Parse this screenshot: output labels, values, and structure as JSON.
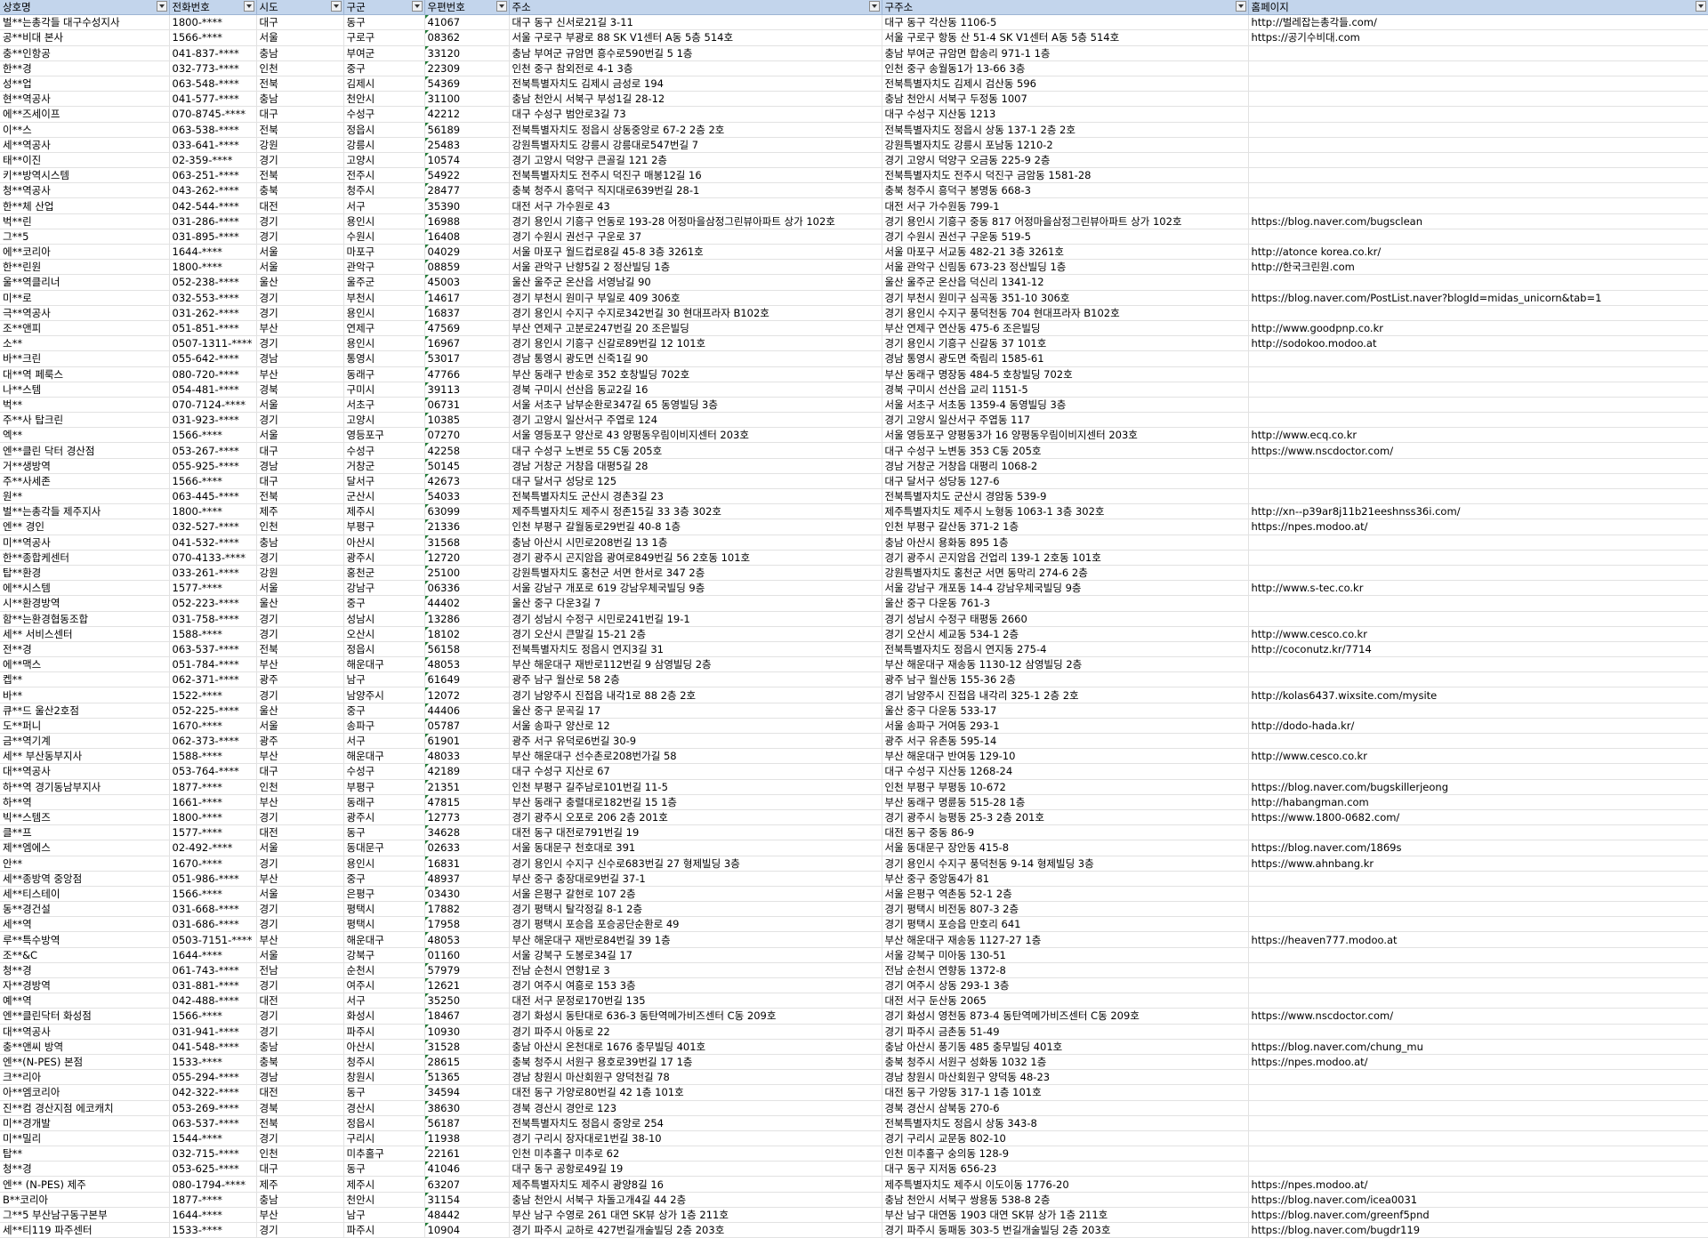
{
  "headers": [
    "상호명",
    "전화번호",
    "시도",
    "구군",
    "우편번호",
    "주소",
    "구주소",
    "홈페이지"
  ],
  "rows": [
    [
      "벌**는총각들 대구수성지사",
      "1800-****",
      "대구",
      "동구",
      "41067",
      "대구 동구 신서로21길 3-11",
      "대구 동구 각산동 1106-5",
      "http://벌레잡는총각들.com/"
    ],
    [
      "공**비대 본사",
      "1566-****",
      "서울",
      "구로구",
      "08362",
      "서울 구로구 부광로 88 SK V1센터 A동 5층 514호",
      "서울 구로구 항동 산 51-4 SK V1센터 A동 5층 514호",
      "https://공기수비대.com"
    ],
    [
      "충**인항공",
      "041-837-****",
      "충남",
      "부여군",
      "33120",
      "충남 부여군 규암면 흥수로590번길 5 1층",
      "충남 부여군 규암면 합송리 971-1 1층",
      ""
    ],
    [
      "한**경",
      "032-773-****",
      "인천",
      "중구",
      "22309",
      "인천 중구 참외전로 4-1 3층",
      "인천 중구 송월동1가 13-66 3층",
      ""
    ],
    [
      "성**업",
      "063-548-****",
      "전북",
      "김제시",
      "54369",
      "전북특별자치도 김제시 금성로 194",
      "전북특별자치도 김제시 검산동 596",
      ""
    ],
    [
      "현**역공사",
      "041-577-****",
      "충남",
      "천안시",
      "31100",
      "충남 천안시 서북구 부성1길 28-12",
      "충남 천안시 서북구 두정동 1007",
      ""
    ],
    [
      "에**즈세이프",
      "070-8745-****",
      "대구",
      "수성구",
      "42212",
      "대구 수성구 범안로3길 73",
      "대구 수성구 지산동 1213",
      ""
    ],
    [
      "이**스",
      "063-538-****",
      "전북",
      "정읍시",
      "56189",
      "전북특별자치도 정읍시 상동중앙로 67-2 2층 2호",
      "전북특별자치도 정읍시 상동 137-1 2층 2호",
      ""
    ],
    [
      "세**역공사",
      "033-641-****",
      "강원",
      "강릉시",
      "25483",
      "강원특별자치도 강릉시 강릉대로547번길 7",
      "강원특별자치도 강릉시 포남동 1210-2",
      ""
    ],
    [
      "태**이진",
      "02-359-****",
      "경기",
      "고양시",
      "10574",
      "경기 고양시 덕양구 큰골길 121 2층",
      "경기 고양시 덕양구 오금동 225-9 2층",
      ""
    ],
    [
      "키**방역시스템",
      "063-251-****",
      "전북",
      "전주시",
      "54922",
      "전북특별자치도 전주시 덕진구 매봉12길 16",
      "전북특별자치도 전주시 덕진구 금암동 1581-28",
      ""
    ],
    [
      "청**역공사",
      "043-262-****",
      "충북",
      "청주시",
      "28477",
      "충북 청주시 흥덕구 직지대로639번길 28-1",
      "충북 청주시 흥덕구 봉명동 668-3",
      ""
    ],
    [
      "한**체 산업",
      "042-544-****",
      "대전",
      "서구",
      "35390",
      "대전 서구 가수원로 43",
      "대전 서구 가수원동 799-1",
      ""
    ],
    [
      "벅**린",
      "031-286-****",
      "경기",
      "용인시",
      "16988",
      "경기 용인시 기흥구 언동로 193-28 어정마을삼정그린뷰아파트 상가 102호",
      "경기 용인시 기흥구 중동 817 어정마을삼정그린뷰아파트 상가 102호",
      "https://blog.naver.com/bugsclean"
    ],
    [
      "그**5",
      "031-895-****",
      "경기",
      "수원시",
      "16408",
      "경기 수원시 권선구 구운로 37",
      "경기 수원시 권선구 구운동 519-5",
      ""
    ],
    [
      "에**코리아",
      "1644-****",
      "서울",
      "마포구",
      "04029",
      "서울 마포구 월드컵로8길 45-8 3층 3261호",
      "서울 마포구 서교동 482-21 3층 3261호",
      "http://atonce korea.co.kr/"
    ],
    [
      "한**린원",
      "1800-****",
      "서울",
      "관악구",
      "08859",
      "서울 관악구 난향5길 2 정산빌딩 1층",
      "서울 관악구 신림동 673-23 정산빌딩 1층",
      "http://한국크린원.com"
    ],
    [
      "울**역클리너",
      "052-238-****",
      "울산",
      "울주군",
      "45003",
      "울산 울주군 온산읍 서영남길 90",
      "울산 울주군 온산읍 덕신리 1341-12",
      ""
    ],
    [
      "미**로",
      "032-553-****",
      "경기",
      "부천시",
      "14617",
      "경기 부천시 원미구 부일로 409 306호",
      "경기 부천시 원미구 심곡동 351-10 306호",
      "https://blog.naver.com/PostList.naver?blogId=midas_unicorn&tab=1"
    ],
    [
      "극**역공사",
      "031-262-****",
      "경기",
      "용인시",
      "16837",
      "경기 용인시 수지구 수지로342번길 30 현대프라자 B102호",
      "경기 용인시 수지구 풍덕천동 704 현대프라자 B102호",
      ""
    ],
    [
      "조**앤피",
      "051-851-****",
      "부산",
      "연제구",
      "47569",
      "부산 연제구 고분로247번길 20 조은빌딩",
      "부산 연제구 연산동 475-6 조은빌딩",
      "http://www.goodpnp.co.kr"
    ],
    [
      "소**",
      "0507-1311-****",
      "경기",
      "용인시",
      "16967",
      "경기 용인시 기흥구 신갈로89번길 12 101호",
      "경기 용인시 기흥구 신갈동 37 101호",
      "http://sodokoo.modoo.at"
    ],
    [
      "바**크린",
      "055-642-****",
      "경남",
      "통영시",
      "53017",
      "경남 통영시 광도면 신죽1길 90",
      "경남 통영시 광도면 죽림리 1585-61",
      ""
    ],
    [
      "대**역 페룩스",
      "080-720-****",
      "부산",
      "동래구",
      "47766",
      "부산 동래구 반송로 352 호창빌딩 702호",
      "부산 동래구 명장동 484-5 호창빌딩 702호",
      ""
    ],
    [
      "나**스템",
      "054-481-****",
      "경북",
      "구미시",
      "39113",
      "경북 구미시 선산읍 동교2길 16",
      "경북 구미시 선산읍 교리 1151-5",
      ""
    ],
    [
      "벅**",
      "070-7124-****",
      "서울",
      "서초구",
      "06731",
      "서울 서초구 남부순환로347길 65 동영빌딩 3층",
      "서울 서초구 서초동 1359-4 동영빌딩 3층",
      ""
    ],
    [
      "주**사 탑크린",
      "031-923-****",
      "경기",
      "고양시",
      "10385",
      "경기 고양시 일산서구 주엽로 124",
      "경기 고양시 일산서구 주엽동 117",
      ""
    ],
    [
      "엑**",
      "1566-****",
      "서울",
      "영등포구",
      "07270",
      "서울 영등포구 양산로 43 양평동우림이비지센터 203호",
      "서울 영등포구 양평동3가 16 양평동우림이비지센터 203호",
      "http://www.ecq.co.kr"
    ],
    [
      "엔**클린 닥터 경산점",
      "053-267-****",
      "대구",
      "수성구",
      "42258",
      "대구 수성구 노변로 55 C동 205호",
      "대구 수성구 노변동 353 C동 205호",
      "https://www.nscdoctor.com/"
    ],
    [
      "거**생방역",
      "055-925-****",
      "경남",
      "거창군",
      "50145",
      "경남 거창군 거창읍 대평5길 28",
      "경남 거창군 거창읍 대평리 1068-2",
      ""
    ],
    [
      "주**사세존",
      "1566-****",
      "대구",
      "달서구",
      "42673",
      "대구 달서구 성당로 125",
      "대구 달서구 성당동 127-6",
      ""
    ],
    [
      "원**",
      "063-445-****",
      "전북",
      "군산시",
      "54033",
      "전북특별자치도 군산시 경촌3길 23",
      "전북특별자치도 군산시 경암동 539-9",
      ""
    ],
    [
      "벌**는총각들 제주지사",
      "1800-****",
      "제주",
      "제주시",
      "63099",
      "제주특별자치도 제주시 정존15길 33 3층 302호",
      "제주특별자치도 제주시 노형동 1063-1 3층 302호",
      "http://xn--p39ar8j11b21eeshnss36i.com/"
    ],
    [
      "엔** 경인",
      "032-527-****",
      "인천",
      "부평구",
      "21336",
      "인천 부평구 갈월동로29번길 40-8 1층",
      "인천 부평구 갈산동 371-2 1층",
      "https://npes.modoo.at/"
    ],
    [
      "미**역공사",
      "041-532-****",
      "충남",
      "아산시",
      "31568",
      "충남 아산시 시민로208번길 13 1층",
      "충남 아산시 용화동 895 1층",
      ""
    ],
    [
      "한**종합케센터",
      "070-4133-****",
      "경기",
      "광주시",
      "12720",
      "경기 광주시 곤지암읍 광여로849번길 56 2호동 101호",
      "경기 광주시 곤지암읍 건업리 139-1 2호동 101호",
      ""
    ],
    [
      "탑**환경",
      "033-261-****",
      "강원",
      "홍천군",
      "25100",
      "강원특별자치도 홍천군 서면 한서로 347 2층",
      "강원특별자치도 홍천군 서면 동막리 274-6 2층",
      ""
    ],
    [
      "에**시스템",
      "1577-****",
      "서울",
      "강남구",
      "06336",
      "서울 강남구 개포로 619 강남우체국빌딩 9층",
      "서울 강남구 개포동 14-4 강남우체국빌딩 9층",
      "http://www.s-tec.co.kr"
    ],
    [
      "시**환경방역",
      "052-223-****",
      "울산",
      "중구",
      "44402",
      "울산 중구 다운3길 7",
      "울산 중구 다운동 761-3",
      ""
    ],
    [
      "함**는환경협동조합",
      "031-758-****",
      "경기",
      "성남시",
      "13286",
      "경기 성남시 수정구 시민로241번길 19-1",
      "경기 성남시 수정구 태평동 2660",
      ""
    ],
    [
      "세** 서비스센터",
      "1588-****",
      "경기",
      "오산시",
      "18102",
      "경기 오산시 큰말길 15-21 2층",
      "경기 오산시 세교동 534-1 2층",
      "http://www.cesco.co.kr"
    ],
    [
      "전**경",
      "063-537-****",
      "전북",
      "정읍시",
      "56158",
      "전북특별자치도 정읍시 연지3길 31",
      "전북특별자치도 정읍시 연지동 275-4",
      "http://coconutz.kr/7714"
    ],
    [
      "에**맥스",
      "051-784-****",
      "부산",
      "해운대구",
      "48053",
      "부산 해운대구 재반로112번길 9 삼영빌딩 2층",
      "부산 해운대구 재송동 1130-12 삼영빌딩 2층",
      ""
    ],
    [
      "켑**",
      "062-371-****",
      "광주",
      "남구",
      "61649",
      "광주 남구 월산로 58 2층",
      "광주 남구 월산동 155-36 2층",
      ""
    ],
    [
      "바**",
      "1522-****",
      "경기",
      "남양주시",
      "12072",
      "경기 남양주시 진접읍 내각1로 88 2층 2호",
      "경기 남양주시 진접읍 내각리 325-1 2층 2호",
      "http://kolas6437.wixsite.com/mysite"
    ],
    [
      "큐**드 울산2호점",
      "052-225-****",
      "울산",
      "중구",
      "44406",
      "울산 중구 문곡길 17",
      "울산 중구 다운동 533-17",
      ""
    ],
    [
      "도**퍼니",
      "1670-****",
      "서울",
      "송파구",
      "05787",
      "서울 송파구 양산로 12",
      "서울 송파구 거여동 293-1",
      "http://dodo-hada.kr/"
    ],
    [
      "금**역기계",
      "062-373-****",
      "광주",
      "서구",
      "61901",
      "광주 서구 유덕로6번길 30-9",
      "광주 서구 유촌동 595-14",
      ""
    ],
    [
      "세** 부산동부지사",
      "1588-****",
      "부산",
      "해운대구",
      "48033",
      "부산 해운대구 선수촌로208번가길 58",
      "부산 해운대구 반여동 129-10",
      "http://www.cesco.co.kr"
    ],
    [
      "대**역공사",
      "053-764-****",
      "대구",
      "수성구",
      "42189",
      "대구 수성구 지산로 67",
      "대구 수성구 지산동 1268-24",
      ""
    ],
    [
      "하**역 경기동남부지사",
      "1877-****",
      "인천",
      "부평구",
      "21351",
      "인천 부평구 길주남로101번길 11-5",
      "인천 부평구 부평동 10-672",
      "https://blog.naver.com/bugskillerjeong"
    ],
    [
      "하**역",
      "1661-****",
      "부산",
      "동래구",
      "47815",
      "부산 동래구 충렬대로182번길 15 1층",
      "부산 동래구 명륜동 515-28 1층",
      "http://habangman.com"
    ],
    [
      "빅**스템즈",
      "1800-****",
      "경기",
      "광주시",
      "12773",
      "경기 광주시 오포로 206 2층 201호",
      "경기 광주시 능평동 25-3 2층 201호",
      "https://www.1800-0682.com/"
    ],
    [
      "클**프",
      "1577-****",
      "대전",
      "동구",
      "34628",
      "대전 동구 대전로791번길 19",
      "대전 동구 중동 86-9",
      ""
    ],
    [
      "제**엠에스",
      "02-492-****",
      "서울",
      "동대문구",
      "02633",
      "서울 동대문구 천호대로 391",
      "서울 동대문구 장안동 415-8",
      "https://blog.naver.com/1869s"
    ],
    [
      "안**",
      "1670-****",
      "경기",
      "용인시",
      "16831",
      "경기 용인시 수지구 신수로683번길 27 형제빌딩 3층",
      "경기 용인시 수지구 풍덕천동 9-14 형제빌딩 3층",
      "https://www.ahnbang.kr"
    ],
    [
      "세**종방역 중앙점",
      "051-986-****",
      "부산",
      "중구",
      "48937",
      "부산 중구 충장대로9번길 37-1",
      "부산 중구 중앙동4가 81",
      ""
    ],
    [
      "세**티스테이",
      "1566-****",
      "서울",
      "은평구",
      "03430",
      "서울 은평구 갈현로 107 2층",
      "서울 은평구 역촌동 52-1 2층",
      ""
    ],
    [
      "동**경건설",
      "031-668-****",
      "경기",
      "평택시",
      "17882",
      "경기 평택시 탈각정길 8-1 2층",
      "경기 평택시 비전동 807-3 2층",
      ""
    ],
    [
      "세**역",
      "031-686-****",
      "경기",
      "평택시",
      "17958",
      "경기 평택시 포승읍 포승공단순환로 49",
      "경기 평택시 포승읍 만호리 641",
      ""
    ],
    [
      "루**특수방역",
      "0503-7151-****",
      "부산",
      "해운대구",
      "48053",
      "부산 해운대구 재반로84번길 39 1층",
      "부산 해운대구 재송동 1127-27 1층",
      "https://heaven777.modoo.at"
    ],
    [
      "조**&C",
      "1644-****",
      "서울",
      "강북구",
      "01160",
      "서울 강북구 도봉로34길 17",
      "서울 강북구 미아동 130-51",
      ""
    ],
    [
      "청**경",
      "061-743-****",
      "전남",
      "순천시",
      "57979",
      "전남 순천시 연향1로 3",
      "전남 순천시 연향동 1372-8",
      ""
    ],
    [
      "자**경방역",
      "031-881-****",
      "경기",
      "여주시",
      "12621",
      "경기 여주시 여흥로 153 3층",
      "경기 여주시 상동 293-1 3층",
      ""
    ],
    [
      "예**역",
      "042-488-****",
      "대전",
      "서구",
      "35250",
      "대전 서구 문정로170번길 135",
      "대전 서구 둔산동 2065",
      ""
    ],
    [
      "엔**클린닥터 화성점",
      "1566-****",
      "경기",
      "화성시",
      "18467",
      "경기 화성시 동탄대로 636-3 동탄역메가비즈센터 C동 209호",
      "경기 화성시 영천동 873-4 동탄역메가비즈센터 C동 209호",
      "https://www.nscdoctor.com/"
    ],
    [
      "대**역공사",
      "031-941-****",
      "경기",
      "파주시",
      "10930",
      "경기 파주시 아동로 22",
      "경기 파주시 금촌동 51-49",
      ""
    ],
    [
      "충**앤씨 방역",
      "041-548-****",
      "충남",
      "아산시",
      "31528",
      "충남 아산시 온천대로 1676 충무빌딩 401호",
      "충남 아산시 풍기동 485 충무빌딩 401호",
      "https://blog.naver.com/chung_mu"
    ],
    [
      "엔**(N-PES) 본점",
      "1533-****",
      "충북",
      "청주시",
      "28615",
      "충북 청주시 서원구 용호로39번길 17 1층",
      "충북 청주시 서원구 성화동 1032 1층",
      "https://npes.modoo.at/"
    ],
    [
      "크**리아",
      "055-294-****",
      "경남",
      "창원시",
      "51365",
      "경남 창원시 마산회원구 양덕천길 78",
      "경남 창원시 마산회원구 양덕동 48-23",
      ""
    ],
    [
      "아**엠코리아",
      "042-322-****",
      "대전",
      "동구",
      "34594",
      "대전 동구 가양로80번길 42 1층 101호",
      "대전 동구 가양동 317-1 1층 101호",
      ""
    ],
    [
      "진**컴 경산지점 에코캐치",
      "053-269-****",
      "경북",
      "경산시",
      "38630",
      "경북 경산시 경안로 123",
      "경북 경산시 삼북동 270-6",
      ""
    ],
    [
      "미**경개발",
      "063-537-****",
      "전북",
      "정읍시",
      "56187",
      "전북특별자치도 정읍시 중앙로 254",
      "전북특별자치도 정읍시 상동 343-8",
      ""
    ],
    [
      "미**밀리",
      "1544-****",
      "경기",
      "구리시",
      "11938",
      "경기 구리시 장자대로1번길 38-10",
      "경기 구리시 교문동 802-10",
      ""
    ],
    [
      "탑**",
      "032-715-****",
      "인천",
      "미추홀구",
      "22161",
      "인천 미추홀구 미추로 62",
      "인천 미추홀구 숭의동 128-9",
      ""
    ],
    [
      "청**경",
      "053-625-****",
      "대구",
      "동구",
      "41046",
      "대구 동구 공항로49길 19",
      "대구 동구 지저동 656-23",
      ""
    ],
    [
      "엔** (N-PES) 제주",
      "080-1794-****",
      "제주",
      "제주시",
      "63207",
      "제주특별자치도 제주시 광양8길 16",
      "제주특별자치도 제주시 이도이동 1776-20",
      "https://npes.modoo.at/"
    ],
    [
      "B**코리아",
      "1877-****",
      "충남",
      "천안시",
      "31154",
      "충남 천안시 서북구 차돌고개4길 44 2층",
      "충남 천안시 서북구 쌍용동 538-8 2층",
      "https://blog.naver.com/icea0031"
    ],
    [
      "그**5 부산남구동구본부",
      "1644-****",
      "부산",
      "남구",
      "48442",
      "부산 남구 수영로 261 대연 SK뷰 상가 1층 211호",
      "부산 남구 대연동 1903 대연 SK뷰 상가 1층 211호",
      "https://blog.naver.com/greenf5pnd"
    ],
    [
      "세**티119 파주센터",
      "1533-****",
      "경기",
      "파주시",
      "10904",
      "경기 파주시 교하로 427번길개술빌딩 2층 203호",
      "경기 파주시 동패동 303-5 번길개술빌딩 2층 203호",
      "https://blog.naver.com/bugdr119"
    ]
  ]
}
